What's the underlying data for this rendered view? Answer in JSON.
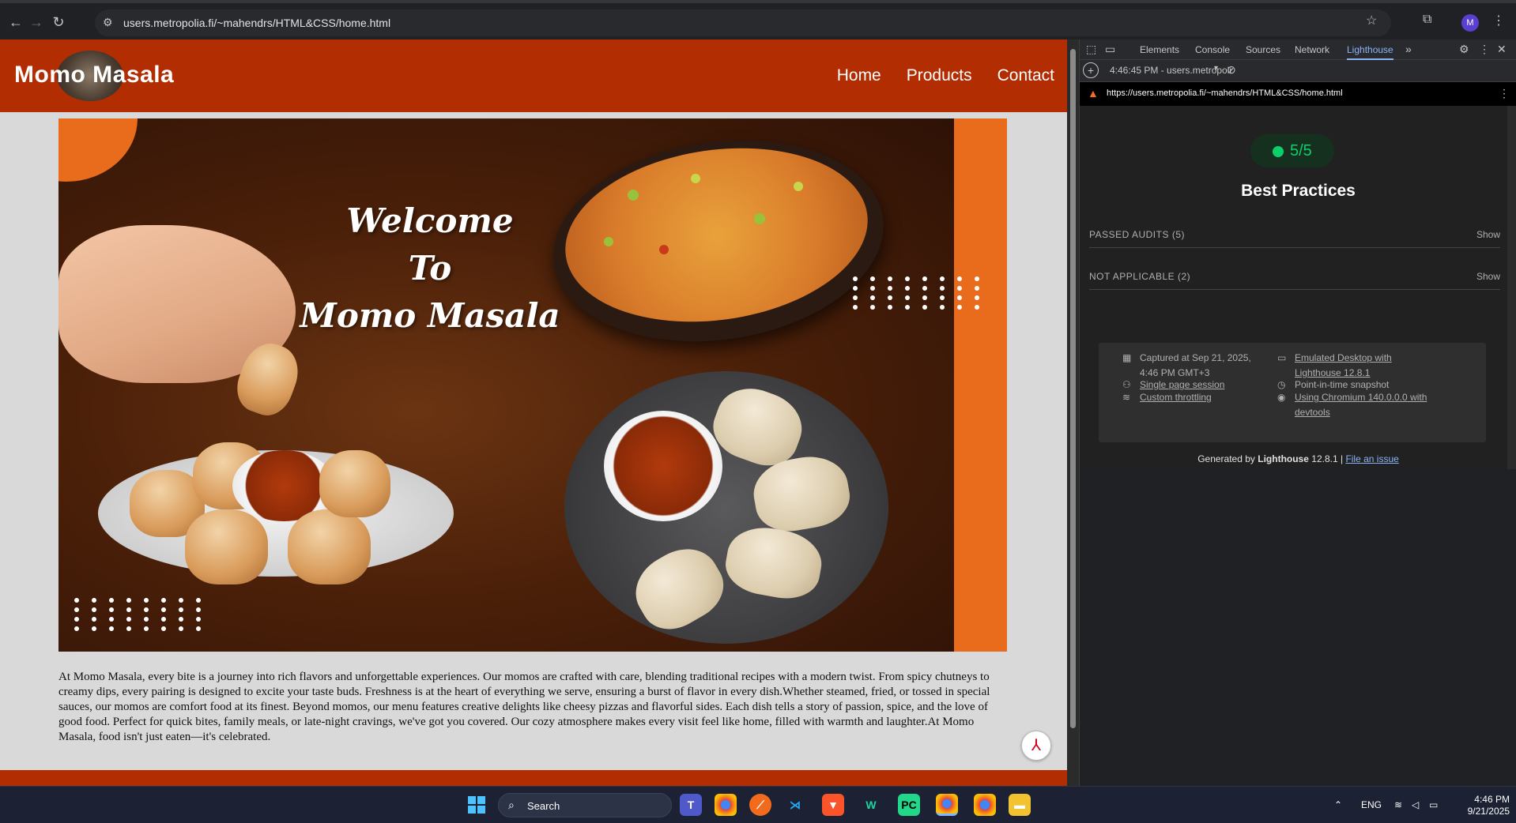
{
  "browser": {
    "url": "users.metropolia.fi/~mahendrs/HTML&CSS/home.html",
    "avatar_initial": "M"
  },
  "site": {
    "logo": "Momo Masala",
    "nav": [
      "Home",
      "Products",
      "Contact"
    ],
    "hero_title_lines": [
      "Welcome",
      "To",
      "Momo Masala"
    ],
    "about": "At Momo Masala, every bite is a journey into rich flavors and unforgettable experiences. Our momos are crafted with care, blending traditional recipes with a modern twist. From spicy chutneys to creamy dips, every pairing is designed to excite your taste buds. Freshness is at the heart of everything we serve, ensuring a burst of flavor in every dish.Whether steamed, fried, or tossed in special sauces, our momos are comfort food at its finest. Beyond momos, our menu features creative delights like cheesy pizzas and flavorful sides. Each dish tells a story of passion, spice, and the love of good food. Perfect for quick bites, family meals, or late-night cravings, we've got you covered. Our cozy atmosphere makes every visit feel like home, filled with warmth and laughter.At Momo Masala, food isn't just eaten—it's celebrated."
  },
  "devtools": {
    "tabs": [
      "Elements",
      "Console",
      "Sources",
      "Network",
      "Lighthouse"
    ],
    "active_tab": "Lighthouse",
    "report_selector": "4:46:45 PM - users.metropoli",
    "report_url": "https://users.metropolia.fi/~mahendrs/HTML&CSS/home.html",
    "score": "5/5",
    "category": "Best Practices",
    "passed_audits": "PASSED AUDITS",
    "passed_count": "(5)",
    "not_applicable": "NOT APPLICABLE",
    "na_count": "(2)",
    "show": "Show",
    "meta": {
      "captured": "Captured at Sep 21, 2025, 4:46 PM GMT+3",
      "session": "Single page session",
      "throttling": "Custom throttling",
      "emulated": "Emulated Desktop with Lighthouse 12.8.1",
      "snapshot": "Point-in-time snapshot",
      "chromium": "Using Chromium 140.0.0.0 with devtools"
    },
    "generated_prefix": "Generated by",
    "generated_name": "Lighthouse",
    "generated_version": "12.8.1 |",
    "file_issue": "File an issue"
  },
  "taskbar": {
    "search": "Search",
    "lang": "ENG",
    "time": "4:46 PM",
    "date": "9/21/2025"
  },
  "colors": {
    "brand": "#b32d02",
    "accent_orange": "#e86c1b",
    "score_green": "#0cce6b",
    "devtools_link": "#8ab4f8"
  }
}
